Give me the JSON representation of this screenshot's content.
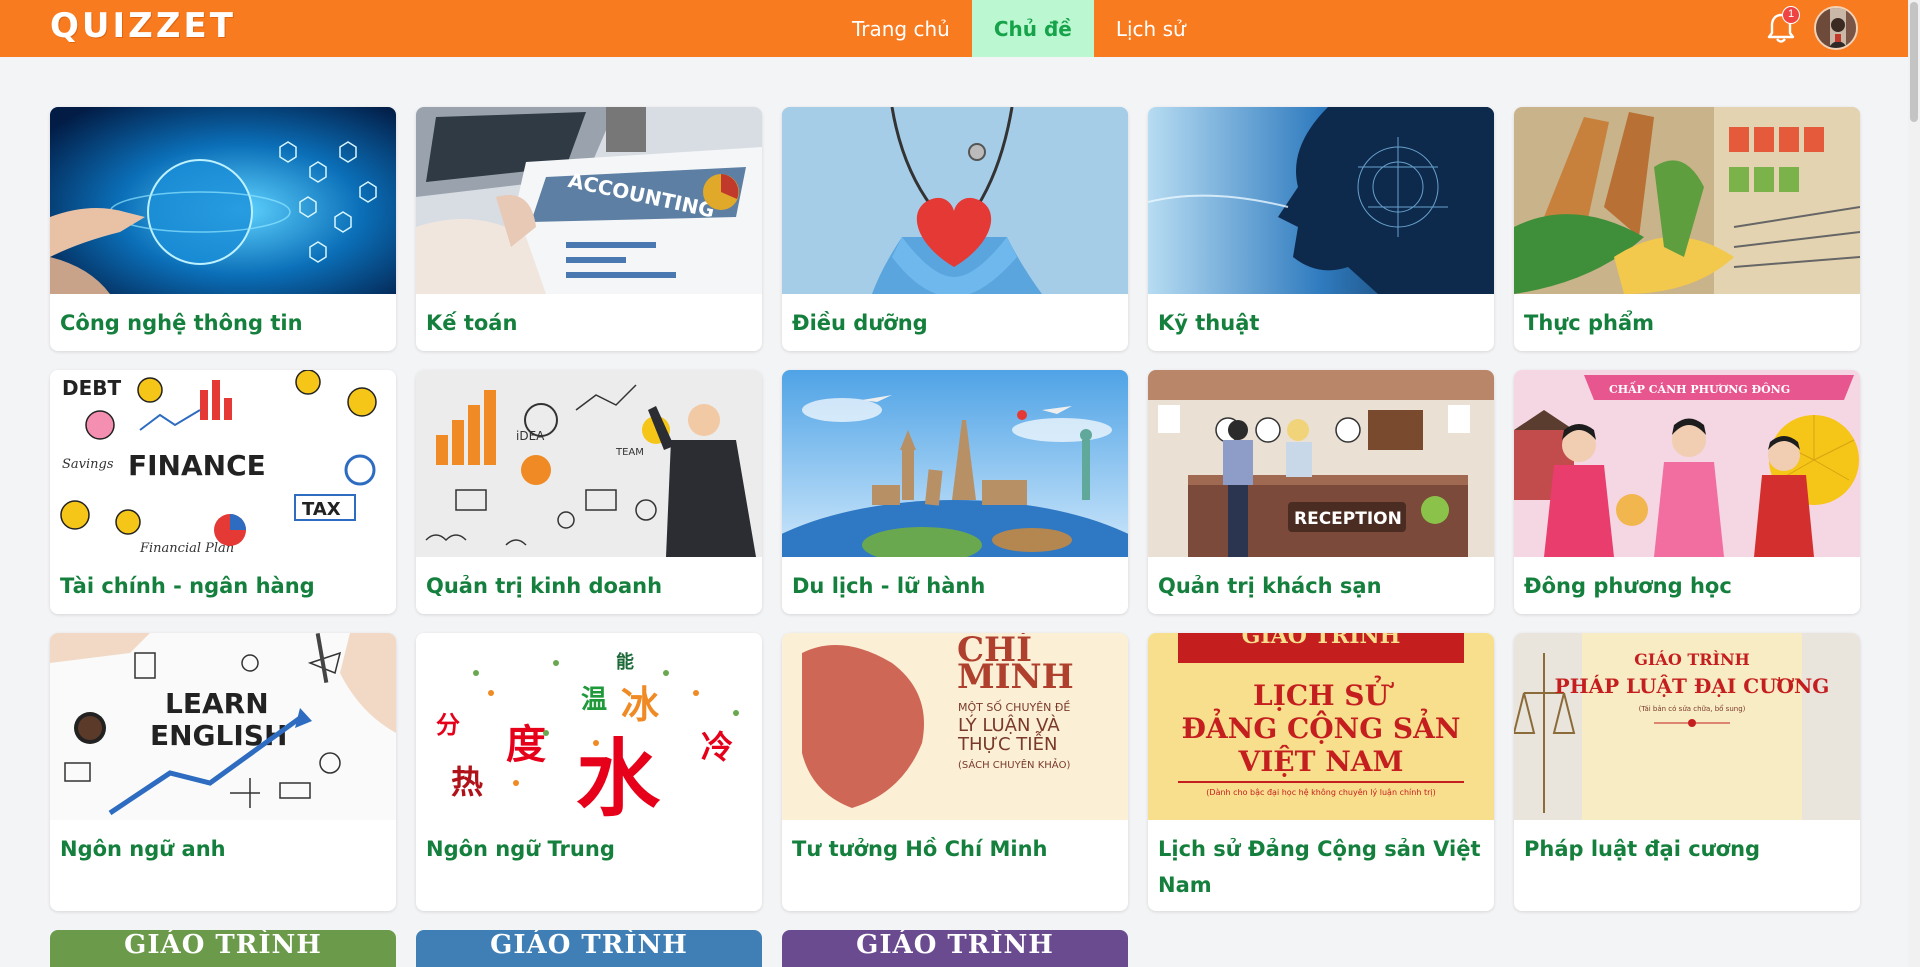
{
  "header": {
    "logo": "QUIZZET",
    "nav": [
      {
        "label": "Trang chủ",
        "active": false
      },
      {
        "label": "Chủ đề",
        "active": true
      },
      {
        "label": "Lịch sử",
        "active": false
      }
    ],
    "notification_count": "1"
  },
  "cards": [
    {
      "title": "Công nghệ thông tin",
      "thumb": "technology-globe"
    },
    {
      "title": "Kế toán",
      "thumb": "accounting-laptop",
      "image_text": "ACCOUNTING"
    },
    {
      "title": "Điều dưỡng",
      "thumb": "nurse-heart"
    },
    {
      "title": "Kỹ thuật",
      "thumb": "tech-head"
    },
    {
      "title": "Thực phẩm",
      "thumb": "grocery-cart"
    },
    {
      "title": "Tài chính - ngân hàng",
      "thumb": "finance-doodle",
      "image_text": [
        "DEBT",
        "FINANCE",
        "TAX",
        "Savings",
        "Financial Plan"
      ]
    },
    {
      "title": "Quản trị kinh doanh",
      "thumb": "business-chart",
      "image_text": [
        "iDEA",
        "TEAM"
      ]
    },
    {
      "title": "Du lịch - lữ hành",
      "thumb": "world-landmarks"
    },
    {
      "title": "Quản trị khách sạn",
      "thumb": "hotel-reception",
      "image_text": "RECEPTION"
    },
    {
      "title": "Đông phương học",
      "thumb": "oriental-girls",
      "image_text": "CHẤP CÁNH PHƯƠNG ĐÔNG"
    },
    {
      "title": "Ngôn ngữ anh",
      "thumb": "learn-english",
      "image_text": [
        "LEARN",
        "ENGLISH"
      ]
    },
    {
      "title": "Ngôn ngữ Trung",
      "thumb": "chinese-characters",
      "image_text": [
        "水",
        "度",
        "冰",
        "温",
        "冷",
        "热",
        "分",
        "能"
      ]
    },
    {
      "title": "Tư tưởng Hồ Chí Minh",
      "thumb": "hcm-book",
      "image_text": [
        "CHÍ",
        "MINH",
        "MỘT SỐ CHUYÊN ĐỀ",
        "LÝ LUẬN VÀ",
        "THỰC TIỄN",
        "(SÁCH CHUYÊN KHẢO)"
      ]
    },
    {
      "title": "Lịch sử Đảng Cộng sản Việt Nam",
      "thumb": "history-book",
      "image_text": [
        "GIÁO TRÌNH",
        "LỊCH SỬ",
        "ĐẢNG CỘNG SẢN",
        "VIỆT NAM",
        "(Dành cho bậc đại học hệ không chuyên lý luận chính trị)"
      ]
    },
    {
      "title": "Pháp luật đại cương",
      "thumb": "law-book",
      "image_text": [
        "GIÁO TRÌNH",
        "PHÁP LUẬT ĐẠI CƯƠNG",
        "(Tái bản có sửa chữa, bổ sung)"
      ]
    }
  ],
  "partial_cards": [
    {
      "image_text": "GIÁO TRÌNH",
      "color": "#6a9a4a"
    },
    {
      "image_text": "GIÁO TRÌNH",
      "color": "#3f7fb5"
    },
    {
      "image_text": "GIÁO TRÌNH",
      "color": "#6b4b8f"
    }
  ],
  "colors": {
    "header": "#f97b1f",
    "active_nav_bg": "#bbf7d0",
    "active_nav_text": "#16a34a",
    "card_title": "#15803d",
    "page_bg": "#f3f4f6"
  }
}
